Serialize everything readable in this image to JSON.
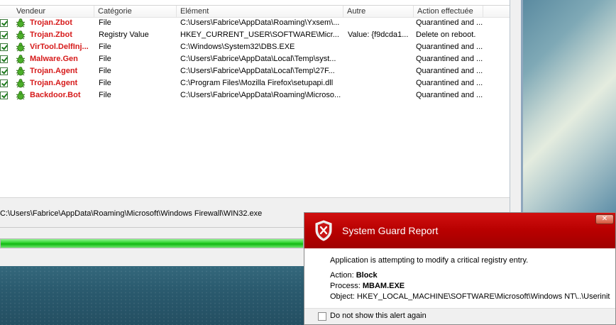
{
  "columns": [
    "Vendeur",
    "Catégorie",
    "Elément",
    "Autre",
    "Action effectuée"
  ],
  "threats": [
    {
      "vendor": "Trojan.Zbot",
      "category": "File",
      "element": "C:\\Users\\Fabrice\\AppData\\Roaming\\Yxsem\\...",
      "other": "",
      "action": "Quarantined and ..."
    },
    {
      "vendor": "Trojan.Zbot",
      "category": "Registry Value",
      "element": "HKEY_CURRENT_USER\\SOFTWARE\\Micr...",
      "other": "Value: {f9dcda1...",
      "action": "Delete on reboot."
    },
    {
      "vendor": "VirTool.DelfInj...",
      "category": "File",
      "element": "C:\\Windows\\System32\\DBS.EXE",
      "other": "",
      "action": "Quarantined and ..."
    },
    {
      "vendor": "Malware.Gen",
      "category": "File",
      "element": "C:\\Users\\Fabrice\\AppData\\Local\\Temp\\syst...",
      "other": "",
      "action": "Quarantined and ..."
    },
    {
      "vendor": "Trojan.Agent",
      "category": "File",
      "element": "C:\\Users\\Fabrice\\AppData\\Local\\Temp\\27F...",
      "other": "",
      "action": "Quarantined and ..."
    },
    {
      "vendor": "Trojan.Agent",
      "category": "File",
      "element": "C:\\Program Files\\Mozilla Firefox\\setupapi.dll",
      "other": "",
      "action": "Quarantined and ..."
    },
    {
      "vendor": "Backdoor.Bot",
      "category": "File",
      "element": "C:\\Users\\Fabrice\\AppData\\Roaming\\Microso...",
      "other": "",
      "action": "Quarantined and ..."
    }
  ],
  "current_path": "C:\\Users\\Fabrice\\AppData\\Roaming\\Microsoft\\Windows Firewall\\WIN32.exe",
  "progress": 1.0,
  "colors": {
    "vendor_text": "#d61a1a",
    "dialog_header": "#b80000",
    "progress_fill": "#2ad12a"
  },
  "dialog": {
    "title": "System Guard Report",
    "message": "Application is attempting to modify a critical registry entry.",
    "action_label": "Action:",
    "action_value": "Block",
    "process_label": "Process:",
    "process_value": "MBAM.EXE",
    "object_label": "Object:",
    "object_value": "HKEY_LOCAL_MACHINE\\SOFTWARE\\Microsoft\\Windows NT\\..\\Userinit",
    "checkbox_label": "Do not show this alert again",
    "close_symbol": "✕"
  }
}
